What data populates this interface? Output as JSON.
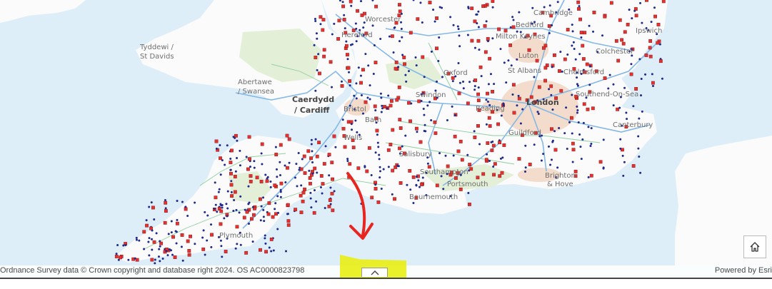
{
  "map": {
    "colors": {
      "sea": "#ddeef8",
      "land": "#fbfbfb",
      "urban": "#f3dccb",
      "green": "#e3efd6",
      "road": "#84b8e6",
      "minor_road": "#8ccfa0",
      "point_red": "#e53030",
      "point_blue": "#1e2a8c"
    },
    "places": [
      {
        "label": "Worcester",
        "cls": "place"
      },
      {
        "label": "Hereford",
        "cls": "place"
      },
      {
        "label": "Cambridge",
        "cls": "place"
      },
      {
        "label": "Bedford",
        "cls": "place"
      },
      {
        "label": "Ipswich",
        "cls": "place"
      },
      {
        "label": "Milton Keynes",
        "cls": "place"
      },
      {
        "label": "Luton",
        "cls": "place"
      },
      {
        "label": "Colchester",
        "cls": "place"
      },
      {
        "label": "Tyddewi /",
        "cls": "place"
      },
      {
        "label": "St Davids",
        "cls": "place"
      },
      {
        "label": "Oxford",
        "cls": "place"
      },
      {
        "label": "St Albans",
        "cls": "place"
      },
      {
        "label": "Chelmsford",
        "cls": "place"
      },
      {
        "label": "Abertawe",
        "cls": "place"
      },
      {
        "label": "/ Swansea",
        "cls": "place"
      },
      {
        "label": "Caerdydd",
        "cls": "place city"
      },
      {
        "label": "/ Cardiff",
        "cls": "place city"
      },
      {
        "label": "Bristol",
        "cls": "place"
      },
      {
        "label": "Swindon",
        "cls": "place"
      },
      {
        "label": "Southend-On-Sea",
        "cls": "place"
      },
      {
        "label": "London",
        "cls": "place city"
      },
      {
        "label": "Reading",
        "cls": "place"
      },
      {
        "label": "Bath",
        "cls": "place"
      },
      {
        "label": "Wells",
        "cls": "place"
      },
      {
        "label": "Canterbury",
        "cls": "place"
      },
      {
        "label": "Guildford",
        "cls": "place"
      },
      {
        "label": "Salisbury",
        "cls": "place"
      },
      {
        "label": "Southampton",
        "cls": "place"
      },
      {
        "label": "Brighton",
        "cls": "place"
      },
      {
        "label": "& Hove",
        "cls": "place"
      },
      {
        "label": "Portsmouth",
        "cls": "place"
      },
      {
        "label": "Bournemouth",
        "cls": "place"
      },
      {
        "label": "Plymouth",
        "cls": "place"
      }
    ],
    "annotation_color": "#e8251f",
    "highlight_color": "#e8ef18"
  },
  "footer": {
    "attribution": "Ordnance Survey data © Crown copyright and database right 2024. OS AC0000823798",
    "powered_by": "Powered by Esri"
  },
  "controls": {
    "expand_icon": "chevron-up-icon",
    "home_icon": "home-icon"
  }
}
